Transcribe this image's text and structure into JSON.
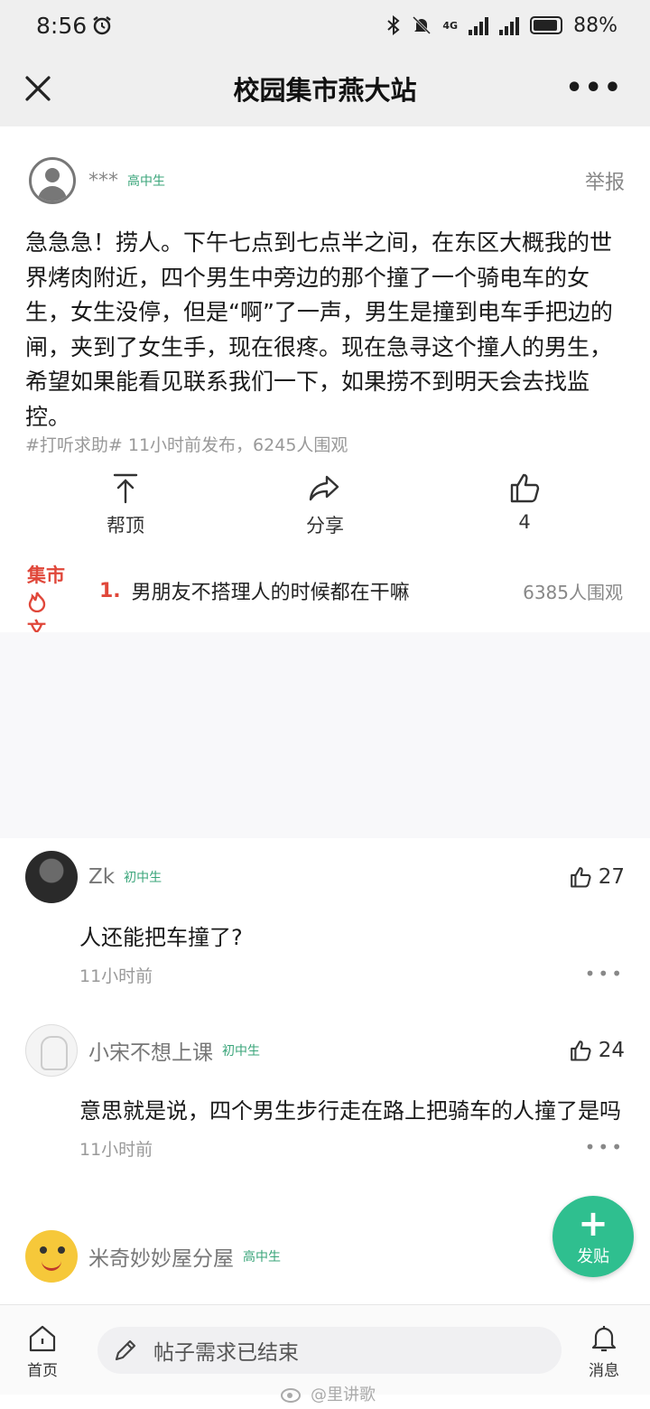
{
  "status_bar": {
    "time": "8:56",
    "network": "4G",
    "battery": "88%"
  },
  "title_bar": {
    "title": "校园集市燕大站",
    "more": "•••"
  },
  "post": {
    "user": "***",
    "grade": "高中生",
    "report": "举报",
    "body": "急急急！捞人。下午七点到七点半之间，在东区大概我的世界烤肉附近，四个男生中旁边的那个撞了一个骑电车的女生，女生没停，但是“啊”了一声，男生是撞到电车手把边的闸，夹到了女生手，现在很疼。现在急寻这个撞人的男生，希望如果能看见联系我们一下，如果捞不到明天会去找监控。",
    "meta": "#打听求助#  11小时前发布，6245人围观"
  },
  "actions": {
    "bump": "帮顶",
    "share": "分享",
    "like_count": "4"
  },
  "hot": {
    "logo_line1": "集市",
    "logo_line2": "文",
    "rank": "1.",
    "title": "男朋友不搭理人的时候都在干嘛",
    "views": "6385人围观"
  },
  "comments": [
    {
      "name": "Zk",
      "grade": "初中生",
      "likes": "27",
      "text": "人还能把车撞了?",
      "time": "11小时前",
      "more": "•••"
    },
    {
      "name": "小宋不想上课",
      "grade": "初中生",
      "likes": "24",
      "text": "意思就是说，四个男生步行走在路上把骑车的人撞了是吗",
      "time": "11小时前",
      "more": "•••"
    },
    {
      "name": "米奇妙妙屋分屋",
      "grade": "高中生"
    }
  ],
  "fab": {
    "plus": "+",
    "label": "发贴"
  },
  "bottom_bar": {
    "home": "首页",
    "input_placeholder": "帖子需求已结束",
    "messages": "消息"
  },
  "watermark": "@里讲歌",
  "colors": {
    "accent_green": "#2fbf8f",
    "hot_red": "#e0473a",
    "grade_green": "#3aa57a"
  }
}
